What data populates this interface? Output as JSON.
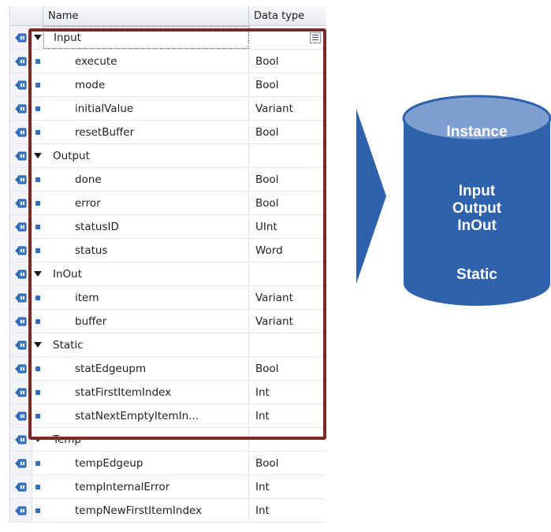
{
  "table": {
    "headers": {
      "name": "Name",
      "type": "Data type"
    },
    "rows": [
      {
        "kind": "section",
        "name": "Input",
        "type": ""
      },
      {
        "kind": "var",
        "name": "execute",
        "type": "Bool"
      },
      {
        "kind": "var",
        "name": "mode",
        "type": "Bool"
      },
      {
        "kind": "var",
        "name": "initialValue",
        "type": "Variant"
      },
      {
        "kind": "var",
        "name": "resetBuffer",
        "type": "Bool"
      },
      {
        "kind": "section",
        "name": "Output",
        "type": ""
      },
      {
        "kind": "var",
        "name": "done",
        "type": "Bool"
      },
      {
        "kind": "var",
        "name": "error",
        "type": "Bool"
      },
      {
        "kind": "var",
        "name": "statusID",
        "type": "UInt"
      },
      {
        "kind": "var",
        "name": "status",
        "type": "Word"
      },
      {
        "kind": "section",
        "name": "InOut",
        "type": ""
      },
      {
        "kind": "var",
        "name": "item",
        "type": "Variant"
      },
      {
        "kind": "var",
        "name": "buffer",
        "type": "Variant"
      },
      {
        "kind": "section",
        "name": "Static",
        "type": ""
      },
      {
        "kind": "var",
        "name": "statEdgeupm",
        "type": "Bool"
      },
      {
        "kind": "var",
        "name": "statFirstItemIndex",
        "type": "Int"
      },
      {
        "kind": "var",
        "name": "statNextEmptyItemIn...",
        "type": "Int"
      },
      {
        "kind": "section",
        "name": "Temp",
        "type": ""
      },
      {
        "kind": "var",
        "name": "tempEdgeup",
        "type": "Bool"
      },
      {
        "kind": "var",
        "name": "tempInternalError",
        "type": "Int"
      },
      {
        "kind": "var",
        "name": "tempNewFirstItemIndex",
        "type": "Int"
      }
    ]
  },
  "cylinder": {
    "title": "Instance",
    "lines": [
      "Input",
      "Output",
      "InOut"
    ],
    "footer": "Static"
  },
  "colors": {
    "highlight_border": "#7a2a22",
    "cylinder_body": "#2e62ad",
    "cylinder_top": "#7f9fd0",
    "arrow": "#2e62ad",
    "bullet": "#2f6ec4"
  },
  "icons": {
    "row_icon": "interface-pin-icon",
    "section_expander": "triangle-down-icon",
    "variable_marker": "square-bullet-icon",
    "dropdown": "list-dropdown-icon"
  }
}
